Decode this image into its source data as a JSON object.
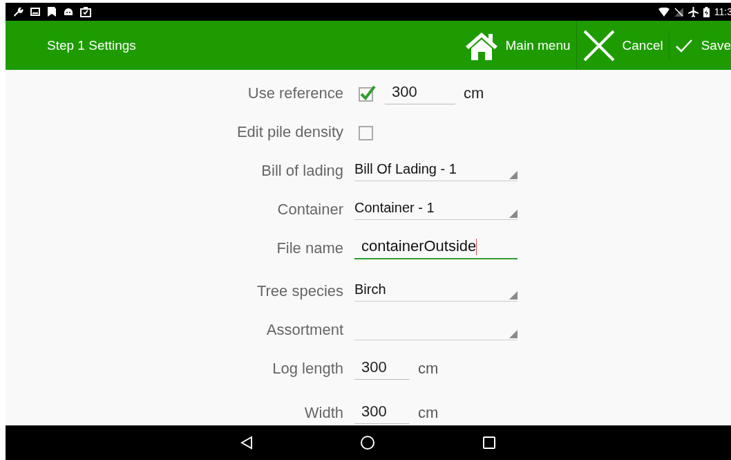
{
  "status_bar": {
    "time": "11:3"
  },
  "toolbar": {
    "title": "Step 1 Settings",
    "actions": [
      {
        "kind": "home",
        "label": "Main menu"
      },
      {
        "kind": "close",
        "label": "Cancel"
      },
      {
        "kind": "check",
        "label": "Save"
      }
    ]
  },
  "form": [
    {
      "kind": "checkbox-number",
      "label": "Use reference",
      "checked": true,
      "value": "300",
      "unit": "cm"
    },
    {
      "kind": "checkbox",
      "label": "Edit pile density",
      "checked": false
    },
    {
      "kind": "dropdown",
      "label": "Bill of lading",
      "value": "Bill Of Lading - 1"
    },
    {
      "kind": "dropdown",
      "label": "Container",
      "value": "Container - 1"
    },
    {
      "kind": "text",
      "label": "File name",
      "value": "containerOutside",
      "focused": true
    },
    {
      "kind": "dropdown",
      "label": "Tree species",
      "value": "Birch"
    },
    {
      "kind": "dropdown",
      "label": "Assortment"
    },
    {
      "kind": "number",
      "label": "Log length",
      "value": "300",
      "unit": "cm"
    },
    {
      "kind": "number",
      "label": "Width",
      "value": "300",
      "unit": "cm"
    }
  ]
}
